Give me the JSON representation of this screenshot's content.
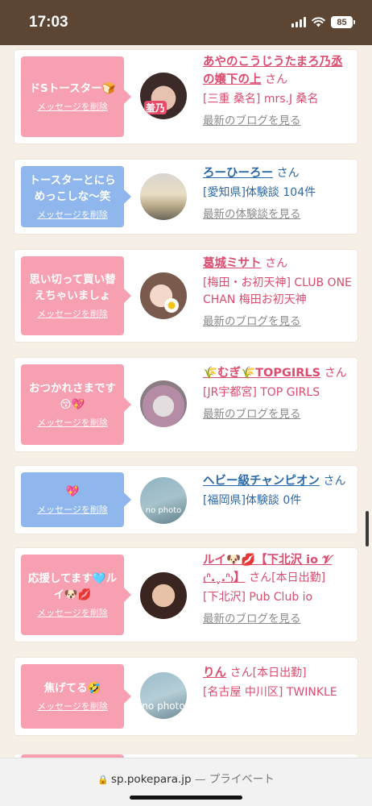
{
  "status_bar": {
    "time": "17:03",
    "battery": "85"
  },
  "url_bar": {
    "domain": "sp.pokepara.jp",
    "separator": "—",
    "mode": "プライベート"
  },
  "delete_label": "メッセージを削除",
  "items": [
    {
      "message": "ドSトースター🍞",
      "name": "あやのこうじうたまろ乃丞の嬢下の上",
      "suffix": "さん",
      "shop": "[三重 桑名] mrs.J 桑名",
      "link": "最新のブログを見る",
      "sticker": "羞乃"
    },
    {
      "message": "トースターとにらめっこしな〜笑",
      "name": "ろーひーろー",
      "suffix": "さん",
      "shop": "[愛知県]体験談 104件",
      "link": "最新の体験談を見る"
    },
    {
      "message": "思い切って買い替えちゃいましょ",
      "name": "葛城ミサト",
      "suffix": "さん",
      "shop": "[梅田・お初天神] CLUB ONE CHAN 梅田お初天神",
      "link": "最新のブログを見る"
    },
    {
      "message": "おつかれさまです😚💖",
      "name": "🌾むぎ🌾TOPGIRLS",
      "suffix": "さん",
      "shop": "[JR宇都宮] TOP GIRLS",
      "link": "最新のブログを見る"
    },
    {
      "message": "💖",
      "name": "ヘビー級チャンピオン",
      "suffix": "さん",
      "shop": "[福岡県]体験談 0件",
      "avatar_text": "no photo"
    },
    {
      "message": "応援してます🩵ルイ🐶💋",
      "name": "ルイ🐶💋【下北沢 io 𝓥 ₍ᐢ.ˬ.ᐢ₎】",
      "suffix": "さん",
      "tag": "[本日出勤]",
      "shop": "[下北沢] Pub Club io",
      "link": "最新のブログを見る"
    },
    {
      "message": "焦げてる🤣",
      "name": "りん",
      "suffix": "さん",
      "tag": "[本日出勤]",
      "shop": "[名古屋 中川区] TWINKLE",
      "avatar_text": "no photo"
    }
  ]
}
